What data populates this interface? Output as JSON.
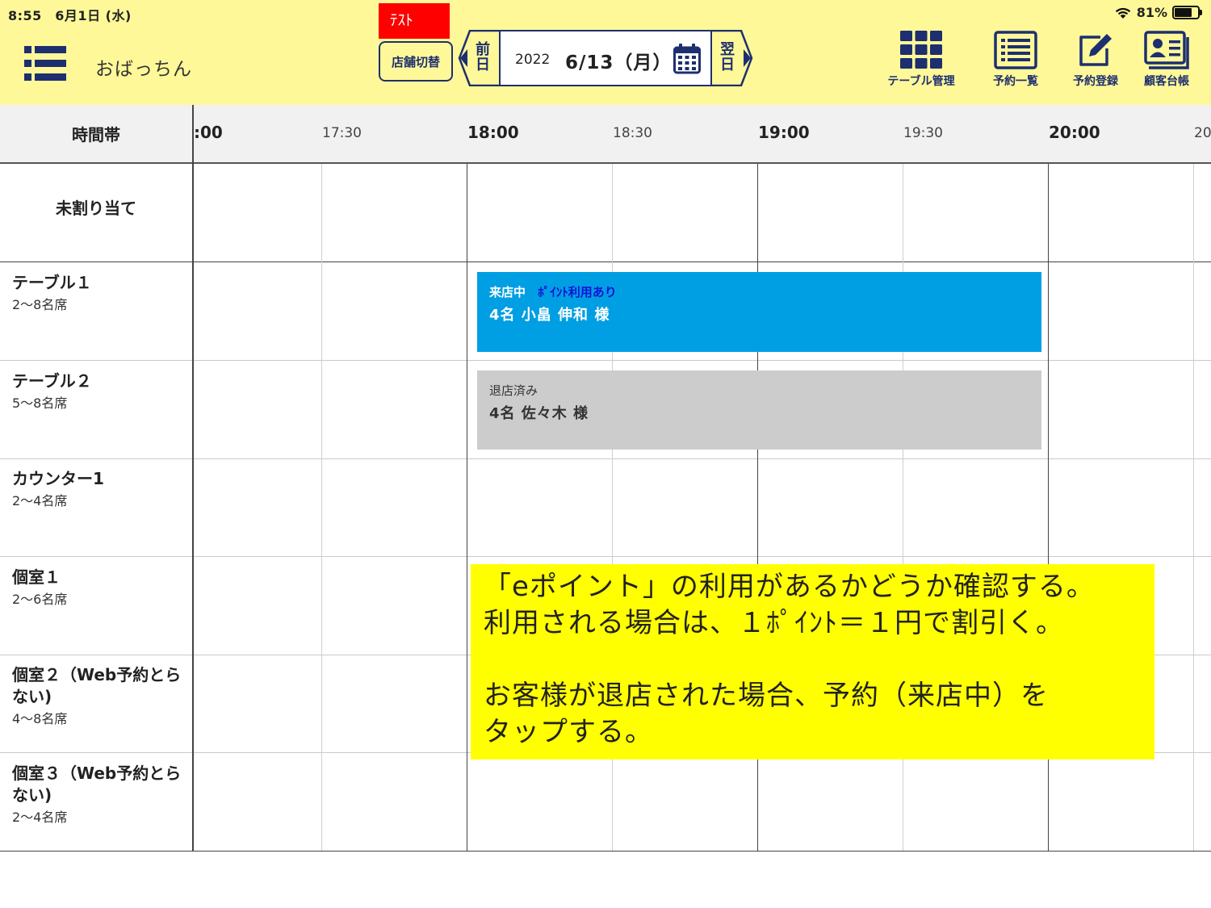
{
  "status_bar": {
    "time": "8:55　6月1日 (水)",
    "battery": "81%",
    "battery_level": 0.81
  },
  "header": {
    "shop_name": "おばっちん",
    "test_badge": "ﾃｽﾄ",
    "shop_switch_label": "店舗切替",
    "prev_day": [
      "前",
      "日"
    ],
    "next_day": [
      "翌",
      "日"
    ],
    "date_year": "2022",
    "date_main": "6/13（月）",
    "tools": [
      {
        "label": "テーブル管理",
        "icon": "table-grid-icon"
      },
      {
        "label": "予約一覧",
        "icon": "list-icon"
      },
      {
        "label": "予約登録",
        "icon": "edit-icon"
      },
      {
        "label": "顧客台帳",
        "icon": "contact-card-icon"
      }
    ],
    "accent_color": "#1d2f6f",
    "header_bg": "#fff899"
  },
  "timeline": {
    "header_label": "時間帯",
    "times": [
      {
        "label": ":00",
        "kind": "major"
      },
      {
        "label": "17:30",
        "kind": "minor"
      },
      {
        "label": "18:00",
        "kind": "major"
      },
      {
        "label": "18:30",
        "kind": "minor"
      },
      {
        "label": "19:00",
        "kind": "major"
      },
      {
        "label": "19:30",
        "kind": "minor"
      },
      {
        "label": "20:00",
        "kind": "major"
      },
      {
        "label": "20",
        "kind": "minor"
      }
    ]
  },
  "rows": [
    {
      "name": "未割り当て",
      "capacity": ""
    },
    {
      "name": "テーブル１",
      "capacity": "2〜8名席"
    },
    {
      "name": "テーブル２",
      "capacity": "5〜8名席"
    },
    {
      "name": "カウンター1",
      "capacity": "2〜4名席"
    },
    {
      "name": "個室１",
      "capacity": "2〜6名席"
    },
    {
      "name": "個室２（Web予約とらない)",
      "capacity": "4〜8名席"
    },
    {
      "name": "個室３（Web予約とらない)",
      "capacity": "2〜4名席"
    }
  ],
  "reservations": [
    {
      "status": "来店中",
      "point_note": "ﾎﾟｲﾝﾄ利用あり",
      "guest": "4名 小畠 伸和 様",
      "color": "#009fe3",
      "start": "18:00",
      "end": "20:00"
    },
    {
      "status": "退店済み",
      "point_note": "",
      "guest": "4名 佐々木 様",
      "color": "#cccccc",
      "start": "18:00",
      "end": "20:00"
    }
  ],
  "note": {
    "lines": [
      "「eポイント」の利用があるかどうか確認する。",
      "利用される場合は、１ﾎﾟｲﾝﾄ＝１円で割引く。",
      "",
      "お客様が退店された場合、予約（来店中）を",
      "タップする。"
    ],
    "bg_color": "#ffff00"
  }
}
